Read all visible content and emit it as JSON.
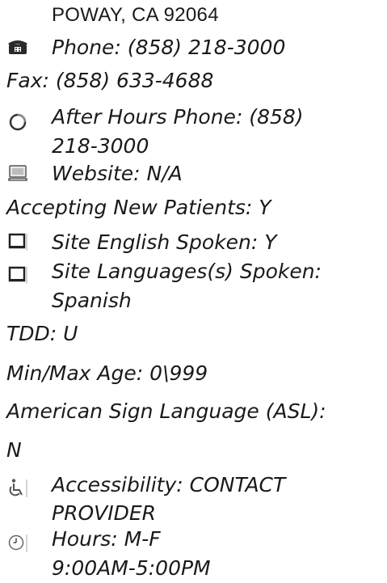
{
  "location": {
    "address_line": "POWAY, CA 92064"
  },
  "contact": {
    "phone": "Phone: (858) 218-3000",
    "fax": "Fax: (858) 633-4688",
    "after_hours_line1": "After Hours Phone: (858)",
    "after_hours_line2": "218-3000",
    "website": "Website: N/A"
  },
  "details": {
    "accepting": "Accepting New Patients: Y",
    "english": "Site English Spoken: Y",
    "languages_line1": "Site Languages(s) Spoken:",
    "languages_line2": "Spanish",
    "tdd": "TDD: U",
    "age": "Min/Max Age: 0\\999",
    "asl_line1": "American Sign Language (ASL):",
    "asl_line2": "N",
    "accessibility_line1": "Accessibility: CONTACT",
    "accessibility_line2": "PROVIDER",
    "hours_line1": "Hours: M-F",
    "hours_line2": "9:00AM-5:00PM"
  },
  "icons": {
    "phone": "phone-icon",
    "after_hours": "after-hours-phone-icon",
    "website": "website-icon",
    "english": "english-language-icon",
    "languages": "languages-icon",
    "accessibility": "wheelchair-icon",
    "hours": "clock-icon"
  }
}
